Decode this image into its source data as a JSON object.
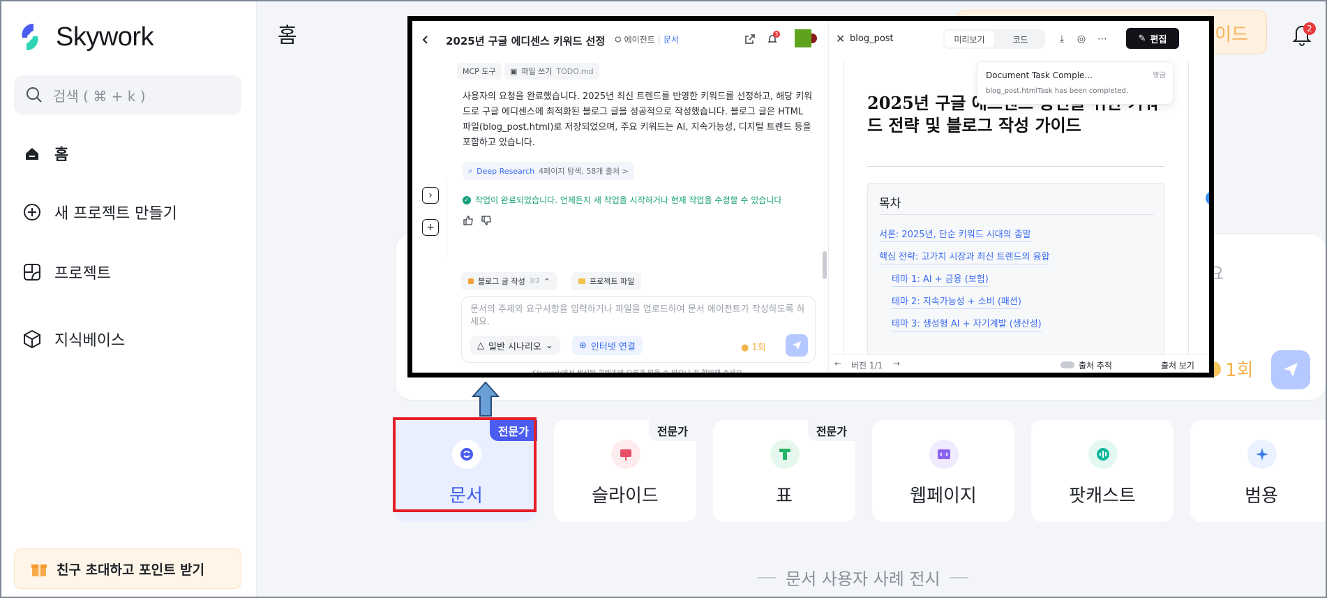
{
  "sidebar": {
    "brand": "Skywork",
    "search_placeholder": "검색 ( ⌘ + k )",
    "items": [
      {
        "label": "홈"
      },
      {
        "label": "새 프로젝트 만들기"
      },
      {
        "label": "프로젝트"
      },
      {
        "label": "지식베이스"
      }
    ],
    "invite_label": "친구 초대하고 포인트 받기"
  },
  "main": {
    "title": "홈",
    "notification_count": "2",
    "peek_orange_text": "이드",
    "peek_input_text": "요",
    "peek_quota": "1회"
  },
  "cards": [
    {
      "label": "문서",
      "badge": "전문가",
      "active": true
    },
    {
      "label": "슬라이드",
      "badge": "전문가"
    },
    {
      "label": "표",
      "badge": "전문가"
    },
    {
      "label": "웹페이지",
      "badge": ""
    },
    {
      "label": "팟캐스트",
      "badge": ""
    },
    {
      "label": "범용",
      "badge": ""
    }
  ],
  "showcase": "문서 사용자 사례 전시",
  "overlay": {
    "left": {
      "title": "2025년 구글 에디센스 키워드 선정",
      "agent_label": "에이전트",
      "agent_type": "문서",
      "notif_count": "3",
      "chip_mcp": "MCP 도구",
      "chip_file": "파일 쓰기",
      "chip_file_name": "TODO.md",
      "paragraph": "사용자의 요청을 완료했습니다. 2025년 최신 트렌드를 반영한 키워드를 선정하고, 해당 키워드로 구글 에디센스에 최적화된 블로그 글을 성공적으로 작성했습니다. 블로그 글은 HTML 파일(blog_post.html)로 저장되었으며, 주요 키워드는 AI, 지속가능성, 디지털 트렌드 등을 포함하고 있습니다.",
      "deep_research": "Deep Research",
      "dr_meta": "4페이지 탐색, 58개 출처 >",
      "done_text": "작업이 완료되었습니다. 언제든지 새 작업을 시작하거나 현재 작업을 수정할 수 있습니다",
      "tab_blog": "블로그 글 작성",
      "tab_blog_count": "3/3",
      "tab_files": "프로젝트 파일",
      "input_placeholder": "문서의 주제와 요구사항을 입력하거나 파일을 업로드하여 문서 에이전트가 작성하도록 하세요.",
      "opt_scenario": "일반 시나리오",
      "opt_internet": "인터넷 연결",
      "quota": "1회",
      "footer": "Skywork에서 생성된 콘텐츠에 오류가 있을 수 있으니 꼭 확인해 주세요."
    },
    "right": {
      "file_name": "blog_post",
      "tab_preview": "미리보기",
      "tab_code": "코드",
      "edit_label": "편집",
      "doc_title": "2025년 구글 애드센스 승인을 위한 키워드 전략 및 블로그 작성 가이드",
      "toc_title": "목차",
      "toc": [
        "서론: 2025년, 단순 키워드 시대의 종말",
        "핵심 전략: 고가치 시장과 최신 트렌드의 융합",
        "테마 1: AI + 금융 (보험)",
        "테마 2: 지속가능성 + 소비 (패션)",
        "테마 3: 생성형 AI + 자기계발 (생산성)"
      ],
      "notif_title": "Document Task Comple...",
      "notif_desc": "blog_post.htmlTask has been completed.",
      "notif_time": "방금",
      "version": "버전 1/1",
      "source_track": "출처 추적",
      "source_view": "출처 보기"
    }
  },
  "colors": {
    "accent": "#3b5bf0",
    "highlight_box": "#e61f26",
    "arrow": "#6a9fd8"
  }
}
